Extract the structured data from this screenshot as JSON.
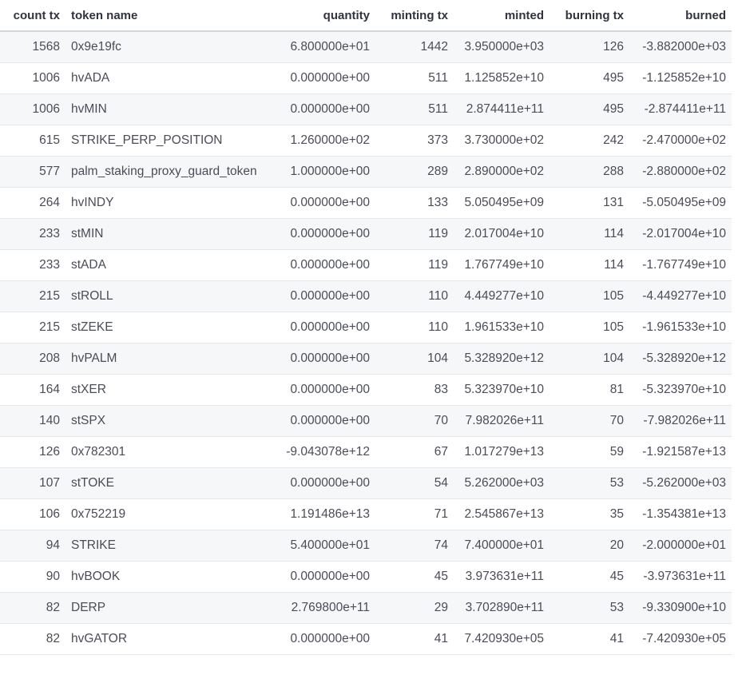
{
  "table": {
    "columns": [
      {
        "key": "count_tx",
        "label": "count tx"
      },
      {
        "key": "token_name",
        "label": "token name"
      },
      {
        "key": "quantity",
        "label": "quantity"
      },
      {
        "key": "minting_tx",
        "label": "minting tx"
      },
      {
        "key": "minted",
        "label": "minted"
      },
      {
        "key": "burning_tx",
        "label": "burning tx"
      },
      {
        "key": "burned",
        "label": "burned"
      }
    ],
    "rows": [
      {
        "count_tx": "1568",
        "token_name": "0x9e19fc",
        "quantity": "6.800000e+01",
        "minting_tx": "1442",
        "minted": "3.950000e+03",
        "burning_tx": "126",
        "burned": "-3.882000e+03"
      },
      {
        "count_tx": "1006",
        "token_name": "hvADA",
        "quantity": "0.000000e+00",
        "minting_tx": "511",
        "minted": "1.125852e+10",
        "burning_tx": "495",
        "burned": "-1.125852e+10"
      },
      {
        "count_tx": "1006",
        "token_name": "hvMIN",
        "quantity": "0.000000e+00",
        "minting_tx": "511",
        "minted": "2.874411e+11",
        "burning_tx": "495",
        "burned": "-2.874411e+11"
      },
      {
        "count_tx": "615",
        "token_name": "STRIKE_PERP_POSITION",
        "quantity": "1.260000e+02",
        "minting_tx": "373",
        "minted": "3.730000e+02",
        "burning_tx": "242",
        "burned": "-2.470000e+02"
      },
      {
        "count_tx": "577",
        "token_name": "palm_staking_proxy_guard_token",
        "quantity": "1.000000e+00",
        "minting_tx": "289",
        "minted": "2.890000e+02",
        "burning_tx": "288",
        "burned": "-2.880000e+02"
      },
      {
        "count_tx": "264",
        "token_name": "hvINDY",
        "quantity": "0.000000e+00",
        "minting_tx": "133",
        "minted": "5.050495e+09",
        "burning_tx": "131",
        "burned": "-5.050495e+09"
      },
      {
        "count_tx": "233",
        "token_name": "stMIN",
        "quantity": "0.000000e+00",
        "minting_tx": "119",
        "minted": "2.017004e+10",
        "burning_tx": "114",
        "burned": "-2.017004e+10"
      },
      {
        "count_tx": "233",
        "token_name": "stADA",
        "quantity": "0.000000e+00",
        "minting_tx": "119",
        "minted": "1.767749e+10",
        "burning_tx": "114",
        "burned": "-1.767749e+10"
      },
      {
        "count_tx": "215",
        "token_name": "stROLL",
        "quantity": "0.000000e+00",
        "minting_tx": "110",
        "minted": "4.449277e+10",
        "burning_tx": "105",
        "burned": "-4.449277e+10"
      },
      {
        "count_tx": "215",
        "token_name": "stZEKE",
        "quantity": "0.000000e+00",
        "minting_tx": "110",
        "minted": "1.961533e+10",
        "burning_tx": "105",
        "burned": "-1.961533e+10"
      },
      {
        "count_tx": "208",
        "token_name": "hvPALM",
        "quantity": "0.000000e+00",
        "minting_tx": "104",
        "minted": "5.328920e+12",
        "burning_tx": "104",
        "burned": "-5.328920e+12"
      },
      {
        "count_tx": "164",
        "token_name": "stXER",
        "quantity": "0.000000e+00",
        "minting_tx": "83",
        "minted": "5.323970e+10",
        "burning_tx": "81",
        "burned": "-5.323970e+10"
      },
      {
        "count_tx": "140",
        "token_name": "stSPX",
        "quantity": "0.000000e+00",
        "minting_tx": "70",
        "minted": "7.982026e+11",
        "burning_tx": "70",
        "burned": "-7.982026e+11"
      },
      {
        "count_tx": "126",
        "token_name": "0x782301",
        "quantity": "-9.043078e+12",
        "minting_tx": "67",
        "minted": "1.017279e+13",
        "burning_tx": "59",
        "burned": "-1.921587e+13"
      },
      {
        "count_tx": "107",
        "token_name": "stTOKE",
        "quantity": "0.000000e+00",
        "minting_tx": "54",
        "minted": "5.262000e+03",
        "burning_tx": "53",
        "burned": "-5.262000e+03"
      },
      {
        "count_tx": "106",
        "token_name": "0x752219",
        "quantity": "1.191486e+13",
        "minting_tx": "71",
        "minted": "2.545867e+13",
        "burning_tx": "35",
        "burned": "-1.354381e+13"
      },
      {
        "count_tx": "94",
        "token_name": "STRIKE",
        "quantity": "5.400000e+01",
        "minting_tx": "74",
        "minted": "7.400000e+01",
        "burning_tx": "20",
        "burned": "-2.000000e+01"
      },
      {
        "count_tx": "90",
        "token_name": "hvBOOK",
        "quantity": "0.000000e+00",
        "minting_tx": "45",
        "minted": "3.973631e+11",
        "burning_tx": "45",
        "burned": "-3.973631e+11"
      },
      {
        "count_tx": "82",
        "token_name": "DERP",
        "quantity": "2.769800e+11",
        "minting_tx": "29",
        "minted": "3.702890e+11",
        "burning_tx": "53",
        "burned": "-9.330900e+10"
      },
      {
        "count_tx": "82",
        "token_name": "hvGATOR",
        "quantity": "0.000000e+00",
        "minting_tx": "41",
        "minted": "7.420930e+05",
        "burning_tx": "41",
        "burned": "-7.420930e+05"
      }
    ]
  }
}
